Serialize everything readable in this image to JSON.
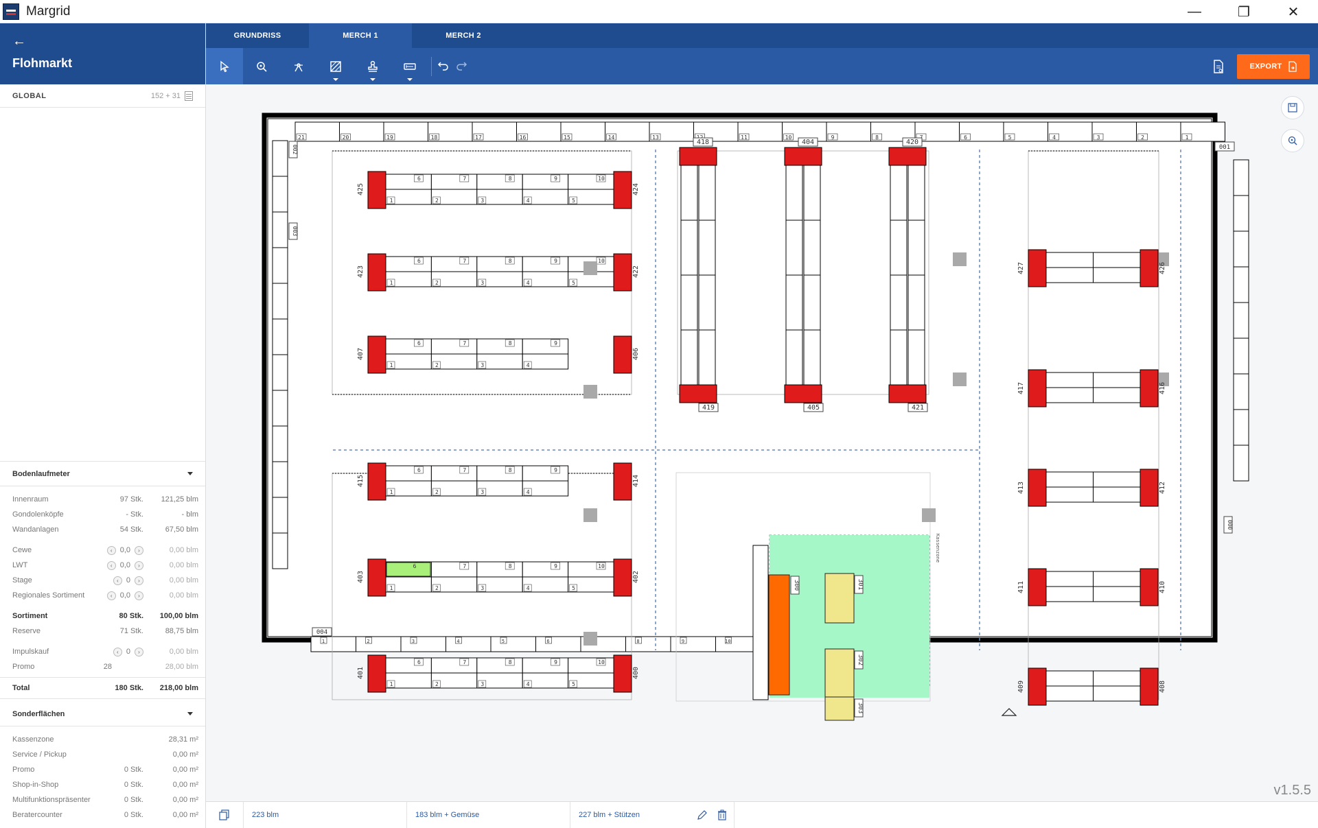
{
  "window": {
    "title": "Margrid",
    "minimize": "—",
    "restore": "❐",
    "close": "✕"
  },
  "sidebar": {
    "project_title": "Flohmarkt",
    "back": "←",
    "global_label": "GLOBAL",
    "global_count": "152 + 31"
  },
  "bodenlaufmeter": {
    "title": "Bodenlaufmeter",
    "rows": [
      {
        "label": "Innenraum",
        "count": "97 Stk.",
        "value": "121,25 blm"
      },
      {
        "label": "Gondolenköpfe",
        "count": "- Stk.",
        "value": "- blm"
      },
      {
        "label": "Wandanlagen",
        "count": "54 Stk.",
        "value": "67,50 blm"
      }
    ],
    "steppers": [
      {
        "label": "Cewe",
        "count": "0,0",
        "value": "0,00 blm"
      },
      {
        "label": "LWT",
        "count": "0,0",
        "value": "0,00 blm"
      },
      {
        "label": "Stage",
        "count": "0",
        "value": "0,00 blm"
      },
      {
        "label": "Regionales Sortiment",
        "count": "0,0",
        "value": "0,00 blm"
      }
    ],
    "sortiment": {
      "label": "Sortiment",
      "count": "80 Stk.",
      "value": "100,00 blm"
    },
    "reserve": {
      "label": "Reserve",
      "count": "71 Stk.",
      "value": "88,75 blm"
    },
    "impulskauf": {
      "label": "Impulskauf",
      "count": "0",
      "value": "0,00 blm"
    },
    "promo": {
      "label": "Promo",
      "count": "28",
      "value": "28,00 blm"
    },
    "total": {
      "label": "Total",
      "count": "180 Stk.",
      "value": "218,00 blm"
    }
  },
  "sonderflaechen": {
    "title": "Sonderflächen",
    "rows": [
      {
        "label": "Kassenzone",
        "count": "",
        "value": "28,31 m²"
      },
      {
        "label": "Service / Pickup",
        "count": "",
        "value": "0,00 m²"
      },
      {
        "label": "Promo",
        "count": "0 Stk.",
        "value": "0,00 m²"
      },
      {
        "label": "Shop-in-Shop",
        "count": "0 Stk.",
        "value": "0,00 m²"
      },
      {
        "label": "Multifunktionspräsenter",
        "count": "0 Stk.",
        "value": "0,00 m²"
      },
      {
        "label": "Beratercounter",
        "count": "0 Stk.",
        "value": "0,00 m²"
      }
    ]
  },
  "tabs": [
    {
      "label": "GRUNDRISS",
      "active": false
    },
    {
      "label": "MERCH 1",
      "active": true
    },
    {
      "label": "MERCH 2",
      "active": false
    }
  ],
  "toolbar": {
    "export_label": "EXPORT"
  },
  "plan": {
    "top_wall_numbers": [
      "21",
      "20",
      "19",
      "18",
      "17",
      "16",
      "15",
      "14",
      "13",
      "12",
      "11",
      "10",
      "9",
      "8",
      "7",
      "6",
      "5",
      "4",
      "3",
      "2",
      "1"
    ],
    "left_wall_labels": [
      "002",
      "003"
    ],
    "right_wall_labels": [
      "001",
      "000"
    ],
    "bottom_wall_label": "004",
    "bottom_wall_numbers": [
      "1",
      "2",
      "3",
      "4",
      "5",
      "6",
      "7",
      "8",
      "9",
      "10"
    ],
    "row_pairs": [
      {
        "left": "425",
        "right": "424",
        "top": [
          "10",
          "9",
          "8",
          "7",
          "6"
        ],
        "bottom": [
          "1",
          "2",
          "3",
          "4",
          "5"
        ]
      },
      {
        "left": "423",
        "right": "422",
        "top": [
          "10",
          "9",
          "8",
          "7",
          "6"
        ],
        "bottom": [
          "1",
          "2",
          "3",
          "4",
          "5"
        ]
      },
      {
        "left": "407",
        "right": "406",
        "top": [
          "9",
          "8",
          "7",
          "6"
        ],
        "bottom": [
          "1",
          "2",
          "3",
          "4"
        ]
      },
      {
        "left": "415",
        "right": "414",
        "top": [
          "9",
          "8",
          "7",
          "6"
        ],
        "bottom": [
          "1",
          "2",
          "3",
          "4"
        ]
      },
      {
        "left": "403",
        "right": "402",
        "top": [
          "10",
          "9",
          "8",
          "7",
          "6"
        ],
        "bottom": [
          "1",
          "2",
          "3",
          "4",
          "5"
        ]
      },
      {
        "left": "401",
        "right": "400",
        "top": [
          "10",
          "9",
          "8",
          "7",
          "6"
        ],
        "bottom": [
          "1",
          "2",
          "3",
          "4",
          "5"
        ]
      }
    ],
    "vertical_gondolas": [
      {
        "top": "418",
        "bottom": "419"
      },
      {
        "top": "404",
        "bottom": "405"
      },
      {
        "top": "420",
        "bottom": "421"
      }
    ],
    "right_pairs": [
      {
        "left": "427",
        "right": "426"
      },
      {
        "left": "417",
        "right": "416"
      },
      {
        "left": "413",
        "right": "412"
      },
      {
        "left": "411",
        "right": "410"
      },
      {
        "left": "409",
        "right": "408"
      }
    ],
    "checkout_labels": [
      "300",
      "301",
      "302",
      "303"
    ],
    "zone_note": "Kassenzone"
  },
  "version": "v1.5.5",
  "statusbar": {
    "field1": "223 blm",
    "field2": "183 blm + Gemüse",
    "field3": "227 blm + Stützen"
  },
  "colors": {
    "primary": "#1f4b8f",
    "toolbar": "#2a5aa3",
    "accent": "#ff6a1a",
    "gondola_head": "#e01b1b",
    "checkout_zone": "#a6f7c8",
    "checkout_counter": "#f0e68c",
    "cashier": "#ff6a00",
    "promo_shelf": "#a8f07a"
  }
}
